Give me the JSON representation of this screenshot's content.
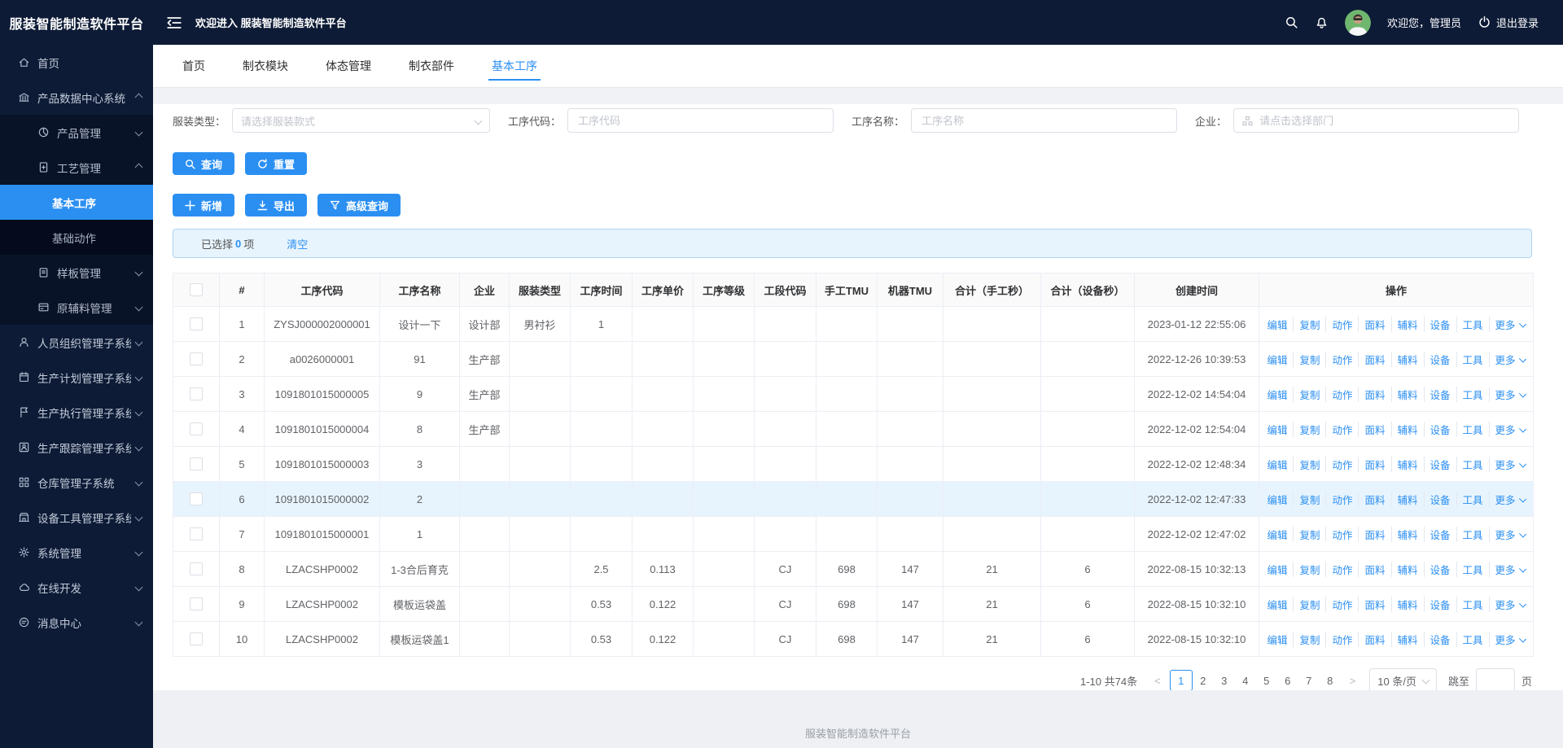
{
  "app": {
    "sidebar_title": "服装智能制造软件平台",
    "welcome": "欢迎进入 服装智能制造软件平台",
    "greeting": "欢迎您，管理员",
    "logout": "退出登录",
    "footer": "服装智能制造软件平台"
  },
  "colors": {
    "accent": "#2b8ff2",
    "sidebar_bg": "#0d1b36",
    "submenu_bg": "#091328",
    "submenu_deep_bg": "#050b1c",
    "row_highlight": "#e8f4fd",
    "alert_bg": "#e8f4fd",
    "alert_border": "#abd3f3",
    "avatar_bg": "#6fb76f"
  },
  "sidebar": {
    "items": [
      {
        "label": "首页",
        "icon": "home-icon"
      },
      {
        "label": "产品数据中心系统",
        "icon": "bank-icon",
        "arrow": "up",
        "expanded": true,
        "children": [
          {
            "label": "产品管理",
            "icon": "pie-icon",
            "arrow": "down"
          },
          {
            "label": "工艺管理",
            "icon": "file-icon",
            "arrow": "up",
            "children": [
              {
                "label": "基本工序",
                "active": true
              },
              {
                "label": "基础动作"
              }
            ]
          },
          {
            "label": "样板管理",
            "icon": "clipboard-icon",
            "arrow": "down"
          },
          {
            "label": "原辅料管理",
            "icon": "card-icon",
            "arrow": "down"
          }
        ]
      },
      {
        "label": "人员组织管理子系统",
        "icon": "person-icon",
        "arrow": "down"
      },
      {
        "label": "生产计划管理子系统",
        "icon": "calendar-icon",
        "arrow": "down"
      },
      {
        "label": "生产执行管理子系统",
        "icon": "flag-icon",
        "arrow": "down"
      },
      {
        "label": "生产跟踪管理子系统",
        "icon": "track-icon",
        "arrow": "down"
      },
      {
        "label": "仓库管理子系统",
        "icon": "grid-icon",
        "arrow": "down"
      },
      {
        "label": "设备工具管理子系统",
        "icon": "device-icon",
        "arrow": "down"
      },
      {
        "label": "系统管理",
        "icon": "gear-icon",
        "arrow": "down"
      },
      {
        "label": "在线开发",
        "icon": "cloud-icon",
        "arrow": "down"
      },
      {
        "label": "消息中心",
        "icon": "message-icon",
        "arrow": "down"
      }
    ]
  },
  "tabs": [
    {
      "label": "首页"
    },
    {
      "label": "制衣模块"
    },
    {
      "label": "体态管理"
    },
    {
      "label": "制衣部件"
    },
    {
      "label": "基本工序",
      "active": true
    }
  ],
  "filters": [
    {
      "label": "服装类型：",
      "placeholder": "请选择服装款式",
      "type": "select"
    },
    {
      "label": "工序代码：",
      "placeholder": "工序代码",
      "type": "input"
    },
    {
      "label": "工序名称：",
      "placeholder": "工序名称",
      "type": "input"
    },
    {
      "label": "企业：",
      "placeholder": "请点击选择部门",
      "type": "input-with-icon"
    }
  ],
  "actions": {
    "search": "查询",
    "reset": "重置",
    "add": "新增",
    "export": "导出",
    "advanced": "高级查询"
  },
  "selection": {
    "prefix": "已选择",
    "count": "0",
    "suffix": "项",
    "clear": "清空"
  },
  "table": {
    "columns": [
      "#",
      "工序代码",
      "工序名称",
      "企业",
      "服装类型",
      "工序时间",
      "工序单价",
      "工序等级",
      "工段代码",
      "手工TMU",
      "机器TMU",
      "合计（手工秒）",
      "合计（设备秒）",
      "创建时间",
      "操作"
    ],
    "row_actions": [
      "编辑",
      "复制",
      "动作",
      "面料",
      "辅料",
      "设备",
      "工具"
    ],
    "more_label": "更多",
    "rows": [
      {
        "cells": [
          "1",
          "ZYSJ000002000001",
          "设计一下",
          "设计部",
          "男衬衫",
          "1",
          "",
          "",
          "",
          "",
          "",
          "",
          "",
          "2023-01-12 22:55:06"
        ]
      },
      {
        "cells": [
          "2",
          "a0026000001",
          "91",
          "生产部",
          "",
          "",
          "",
          "",
          "",
          "",
          "",
          "",
          "",
          "2022-12-26 10:39:53"
        ]
      },
      {
        "cells": [
          "3",
          "1091801015000005",
          "9",
          "生产部",
          "",
          "",
          "",
          "",
          "",
          "",
          "",
          "",
          "",
          "2022-12-02 14:54:04"
        ]
      },
      {
        "cells": [
          "4",
          "1091801015000004",
          "8",
          "生产部",
          "",
          "",
          "",
          "",
          "",
          "",
          "",
          "",
          "",
          "2022-12-02 12:54:04"
        ]
      },
      {
        "cells": [
          "5",
          "1091801015000003",
          "3",
          "",
          "",
          "",
          "",
          "",
          "",
          "",
          "",
          "",
          "",
          "2022-12-02 12:48:34"
        ]
      },
      {
        "cells": [
          "6",
          "1091801015000002",
          "2",
          "",
          "",
          "",
          "",
          "",
          "",
          "",
          "",
          "",
          "",
          "2022-12-02 12:47:33"
        ],
        "highlight": true
      },
      {
        "cells": [
          "7",
          "1091801015000001",
          "1",
          "",
          "",
          "",
          "",
          "",
          "",
          "",
          "",
          "",
          "",
          "2022-12-02 12:47:02"
        ]
      },
      {
        "cells": [
          "8",
          "LZACSHP0002",
          "1-3合后育克",
          "",
          "",
          "2.5",
          "0.113",
          "",
          "CJ",
          "698",
          "147",
          "21",
          "6",
          "2022-08-15 10:32:13"
        ]
      },
      {
        "cells": [
          "9",
          "LZACSHP0002",
          "模板运袋盖",
          "",
          "",
          "0.53",
          "0.122",
          "",
          "CJ",
          "698",
          "147",
          "21",
          "6",
          "2022-08-15 10:32:10"
        ]
      },
      {
        "cells": [
          "10",
          "LZACSHP0002",
          "模板运袋盖1",
          "",
          "",
          "0.53",
          "0.122",
          "",
          "CJ",
          "698",
          "147",
          "21",
          "6",
          "2022-08-15 10:32:10"
        ]
      }
    ]
  },
  "pagination": {
    "total": "1-10 共74条",
    "pages": [
      "1",
      "2",
      "3",
      "4",
      "5",
      "6",
      "7",
      "8"
    ],
    "current": "1",
    "page_size": "10 条/页",
    "jump_label": "跳至",
    "jump_suffix": "页"
  }
}
